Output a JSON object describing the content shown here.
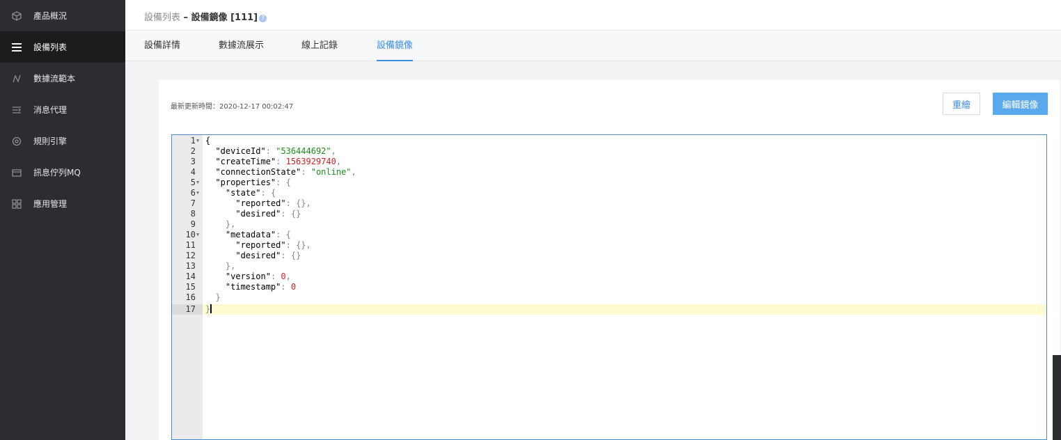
{
  "sidebar": {
    "items": [
      {
        "label": "產品概況",
        "icon": "box-icon"
      },
      {
        "label": "設備列表",
        "icon": "menu-icon",
        "active": true
      },
      {
        "label": "數據流範本",
        "icon": "flow-icon"
      },
      {
        "label": "消息代理",
        "icon": "proxy-icon"
      },
      {
        "label": "規則引擎",
        "icon": "gear-icon"
      },
      {
        "label": "訊息佇列MQ",
        "icon": "queue-icon"
      },
      {
        "label": "應用管理",
        "icon": "grid-icon"
      }
    ]
  },
  "breadcrumb": {
    "parent": "設備列表",
    "separator": " – ",
    "current": "設備鏡像 [111]",
    "help": "?"
  },
  "tabs": [
    {
      "label": "設備詳情"
    },
    {
      "label": "數據流展示"
    },
    {
      "label": "線上記錄"
    },
    {
      "label": "設備鏡像",
      "active": true
    }
  ],
  "panel": {
    "updated_label": "最新更新時間：",
    "updated_value": "2020-12-17 00:02:47",
    "redraw_label": "重繪",
    "edit_label": "編輯鏡像"
  },
  "editor": {
    "lines": [
      {
        "n": "1",
        "fold": true
      },
      {
        "n": "2"
      },
      {
        "n": "3"
      },
      {
        "n": "4"
      },
      {
        "n": "5",
        "fold": true
      },
      {
        "n": "6",
        "fold": true
      },
      {
        "n": "7"
      },
      {
        "n": "8"
      },
      {
        "n": "9"
      },
      {
        "n": "10",
        "fold": true
      },
      {
        "n": "11"
      },
      {
        "n": "12"
      },
      {
        "n": "13"
      },
      {
        "n": "14"
      },
      {
        "n": "15"
      },
      {
        "n": "16"
      },
      {
        "n": "17"
      }
    ],
    "code": {
      "l1": "{",
      "device_id_key": "\"deviceId\"",
      "device_id_val": "\"536444692\"",
      "create_time_key": "\"createTime\"",
      "create_time_val": "1563929740",
      "conn_key": "\"connectionState\"",
      "conn_val": "\"online\"",
      "props_key": "\"properties\"",
      "state_key": "\"state\"",
      "reported_key": "\"reported\"",
      "desired_key": "\"desired\"",
      "metadata_key": "\"metadata\"",
      "version_key": "\"version\"",
      "version_val": "0",
      "timestamp_key": "\"timestamp\"",
      "timestamp_val": "0",
      "close_brace": "}",
      "open_brace": "{",
      "empty_obj": "{}",
      "colon": ": ",
      "comma": ","
    }
  }
}
